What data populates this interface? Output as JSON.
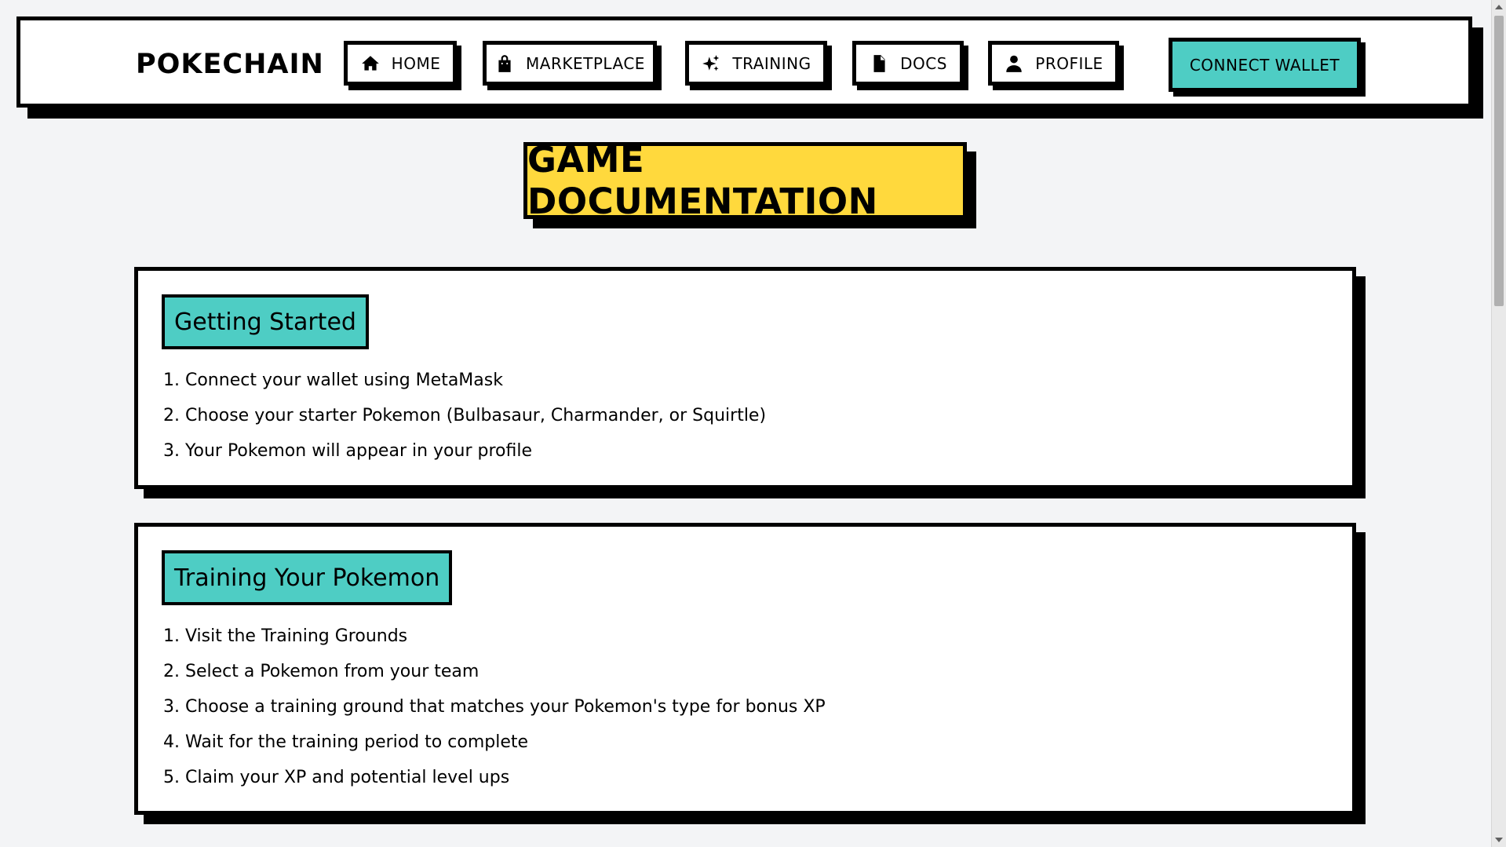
{
  "navbar": {
    "brand": "POKECHAIN",
    "items": [
      {
        "label": "HOME",
        "icon": "home-icon"
      },
      {
        "label": "MARKETPLACE",
        "icon": "shopping-bag-icon"
      },
      {
        "label": "TRAINING",
        "icon": "sparkles-icon"
      },
      {
        "label": "DOCS",
        "icon": "document-icon"
      },
      {
        "label": "PROFILE",
        "icon": "user-icon"
      }
    ],
    "connect_label": "CONNECT WALLET"
  },
  "page": {
    "title": "GAME DOCUMENTATION"
  },
  "sections": [
    {
      "heading": "Getting Started",
      "items": [
        "1. Connect your wallet using MetaMask",
        "2. Choose your starter Pokemon (Bulbasaur, Charmander, or Squirtle)",
        "3. Your Pokemon will appear in your profile"
      ]
    },
    {
      "heading": "Training Your Pokemon",
      "items": [
        "1. Visit the Training Grounds",
        "2. Select a Pokemon from your team",
        "3. Choose a training ground that matches your Pokemon's type for bonus XP",
        "4. Wait for the training period to complete",
        "5. Claim your XP and potential level ups"
      ]
    }
  ],
  "colors": {
    "accent_teal": "#4ecdc4",
    "title_yellow": "#ffd93d",
    "background": "#f3f4f6",
    "border": "#000000"
  }
}
